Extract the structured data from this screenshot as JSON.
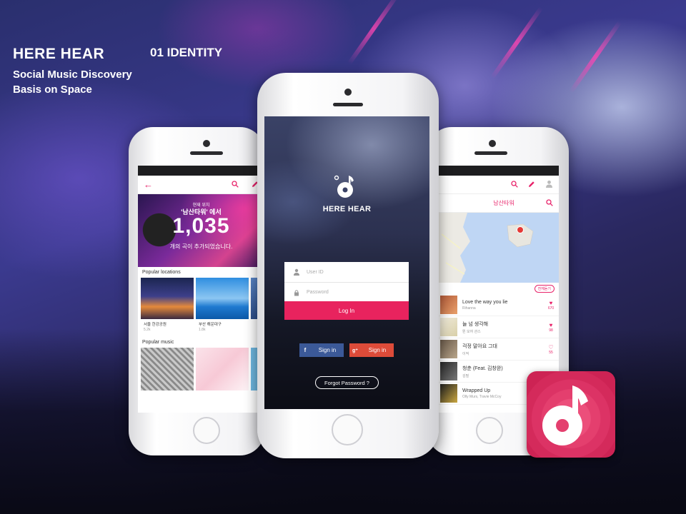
{
  "brand": {
    "title": "HERE HEAR",
    "subtitle_line1": "Social Music Discovery",
    "subtitle_line2": "Basis on Space",
    "section_label": "01 IDENTITY"
  },
  "colors": {
    "accent": "#e8236a",
    "facebook": "#3b5998",
    "google": "#dd4b39"
  },
  "left_screen": {
    "hero": {
      "line1": "현재 위치",
      "line2": "'남산타워' 에서",
      "count": "1,035",
      "line4": "개의 곡이 추가되었습니다."
    },
    "popular_locations_title": "Popular locations",
    "locations": [
      {
        "name": "서울 한강공원",
        "count": "5.2k"
      },
      {
        "name": "부산 해운대구",
        "count": "1.8k"
      }
    ],
    "popular_music_title": "Popular music"
  },
  "center_screen": {
    "logo_text": "HERE HEAR",
    "user_id_placeholder": "User ID",
    "password_placeholder": "Password",
    "login_label": "Log In",
    "facebook_label": "Sign in",
    "google_label": "Sign in",
    "forgot_label": "Forgot Password ?"
  },
  "right_screen": {
    "location_title": "남산타워",
    "filter_label": "전체듣기",
    "songs": [
      {
        "title": "Love the way you lie",
        "artist": "Rihanna",
        "likes": "670",
        "liked": true
      },
      {
        "title": "늘 넘 생각해",
        "artist": "뭔 모여 관스",
        "likes": "98",
        "liked": true
      },
      {
        "title": "걱정 말아요 그대",
        "artist": "이적",
        "likes": "55",
        "liked": false
      },
      {
        "title": "청춘 (Feat. 김창완)",
        "artist": "김필",
        "likes": "",
        "liked": false
      },
      {
        "title": "Wrapped Up",
        "artist": "Olly Murs, Travie McCoy",
        "likes": "",
        "liked": false
      }
    ]
  }
}
